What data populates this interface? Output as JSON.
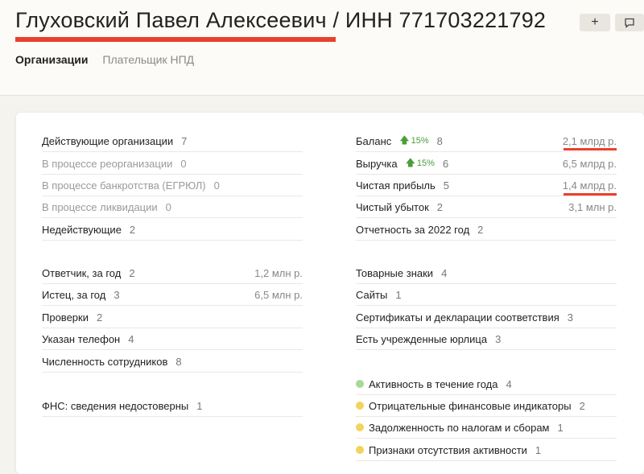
{
  "header": {
    "title": "Глуховский Павел Алексеевич / ИНН 771703221792",
    "add_label": "+",
    "comment_icon": "comment-icon",
    "tabs": [
      {
        "label": "Организации",
        "active": true
      },
      {
        "label": "Плательщик НПД",
        "active": false
      }
    ]
  },
  "left": {
    "status": [
      {
        "label": "Действующие организации",
        "count": "7"
      },
      {
        "label": "В процессе реорганизации",
        "count": "0"
      },
      {
        "label": "В процессе банкротства (ЕГРЮЛ)",
        "count": "0"
      },
      {
        "label": "В процессе ликвидации",
        "count": "0"
      },
      {
        "label": "Недействующие",
        "count": "2"
      }
    ],
    "courts": [
      {
        "label": "Ответчик, за год",
        "count": "2",
        "value": "1,2 млн р."
      },
      {
        "label": "Истец, за год",
        "count": "3",
        "value": "6,5 млн р."
      },
      {
        "label": "Проверки",
        "count": "2"
      },
      {
        "label": "Указан телефон",
        "count": "4"
      },
      {
        "label": "Численность сотрудников",
        "count": "8"
      }
    ],
    "fns": {
      "label": "ФНС: сведения недостоверны",
      "count": "1"
    }
  },
  "right": {
    "finance": [
      {
        "label": "Баланс",
        "growth": "15%",
        "count": "8",
        "value": "2,1 млрд р."
      },
      {
        "label": "Выручка",
        "growth": "15%",
        "count": "6",
        "value": "6,5 млрд р."
      },
      {
        "label": "Чистая прибыль",
        "count": "5",
        "value": "1,4 млрд р."
      },
      {
        "label": "Чистый убыток",
        "count": "2",
        "value": "3,1 млн р."
      },
      {
        "label": "Отчетность за 2022 год",
        "count": "2"
      }
    ],
    "misc": [
      {
        "label": "Товарные знаки",
        "count": "4"
      },
      {
        "label": "Сайты",
        "count": "1"
      },
      {
        "label": "Сертификаты и декларации соответствия",
        "count": "3"
      },
      {
        "label": "Есть учрежденные юрлица",
        "count": "3"
      }
    ],
    "indicators": [
      {
        "label": "Активность в течение года",
        "count": "4",
        "color": "#a8d89a"
      },
      {
        "label": "Отрицательные финансовые индикаторы",
        "count": "2",
        "color": "#f2d35c"
      },
      {
        "label": "Задолженность по налогам и сборам",
        "count": "1",
        "color": "#f2d35c"
      },
      {
        "label": "Признаки отсутствия активности",
        "count": "1",
        "color": "#f2d35c"
      }
    ]
  },
  "colors": {
    "accent_red": "#e8412d",
    "growth_green": "#4a9d3a"
  }
}
